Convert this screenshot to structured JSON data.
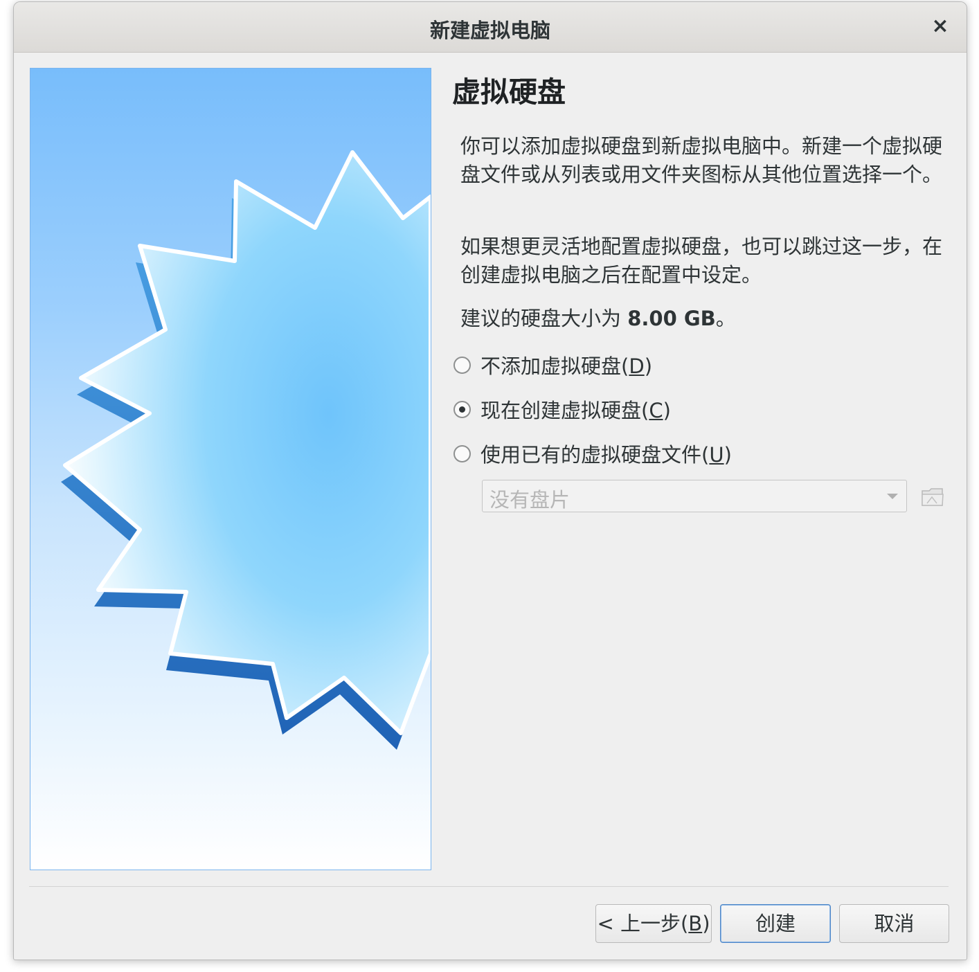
{
  "window": {
    "title": "新建虚拟电脑",
    "close_glyph": "×"
  },
  "page": {
    "title": "虚拟硬盘",
    "para1": "你可以添加虚拟硬盘到新虚拟电脑中。新建一个虚拟硬盘文件或从列表或用文件夹图标从其他位置选择一个。",
    "para2": "如果想更灵活地配置虚拟硬盘，也可以跳过这一步，在创建虚拟电脑之后在配置中设定。",
    "para3_prefix": "建议的硬盘大小为 ",
    "para3_size": "8.00 GB",
    "para3_suffix": "。"
  },
  "options": [
    {
      "label": "不添加虚拟硬盘",
      "mnemonic": "D",
      "checked": false
    },
    {
      "label": "现在创建虚拟硬盘",
      "mnemonic": "C",
      "checked": true
    },
    {
      "label": "使用已有的虚拟硬盘文件",
      "mnemonic": "U",
      "checked": false
    }
  ],
  "disk_select": {
    "value": "没有盘片",
    "enabled": false
  },
  "buttons": {
    "back_prefix": "< 上一步(",
    "back_mnemonic": "B",
    "back_suffix": ")",
    "create": "创建",
    "cancel": "取消"
  },
  "icons": {
    "close": "close-icon",
    "folder": "folder-open-icon",
    "dropdown": "chevron-down-icon"
  },
  "colors": {
    "accent": "#4e86c7",
    "watermark_top": "#78bdfb",
    "watermark_bottom": "#ffffff"
  }
}
